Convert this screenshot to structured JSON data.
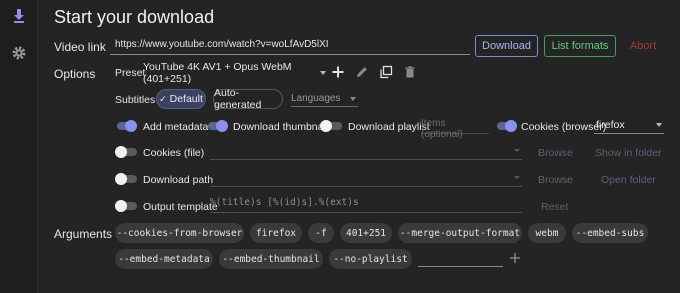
{
  "rail": {
    "icons": [
      "download-icon",
      "gear-icon"
    ]
  },
  "header": {
    "title": "Start your download"
  },
  "video_link": {
    "label": "Video link",
    "value": "https://www.youtube.com/watch?v=woLfAvD5lXI",
    "download_label": "Download",
    "formats_label": "List formats",
    "abort_label": "Abort"
  },
  "options": {
    "label": "Options",
    "preset_label": "Preset",
    "preset_value": "YouTube 4K AV1 + Opus WebM (401+251)",
    "subtitles_label": "Subtitles",
    "subtitles_default": "Default",
    "subtitles_auto": "Auto-generated",
    "languages_placeholder": "Languages"
  },
  "toggles": {
    "metadata": {
      "label": "Add metadata",
      "on": true
    },
    "thumbnail": {
      "label": "Download thumbnail",
      "on": true
    },
    "playlist": {
      "label": "Download playlist",
      "on": false,
      "items_placeholder": "Items (optional)"
    },
    "cookies_browser": {
      "label": "Cookies (browser)",
      "on": true,
      "browser": "firefox"
    },
    "cookies_file": {
      "label": "Cookies (file)",
      "on": false,
      "browse": "Browse",
      "show": "Show in folder"
    },
    "download_path": {
      "label": "Download path",
      "on": false,
      "browse": "Browse",
      "open": "Open folder"
    },
    "output_template": {
      "label": "Output template",
      "on": false,
      "value": "%(title)s [%(id)s].%(ext)s",
      "reset": "Reset"
    }
  },
  "arguments": {
    "label": "Arguments",
    "chips": [
      "--cookies-from-browser",
      "firefox",
      "-f",
      "401+251",
      "--merge-output-format",
      "webm",
      "--embed-subs",
      "--embed-metadata",
      "--embed-thumbnail",
      "--no-playlist"
    ]
  },
  "colors": {
    "accent": "#8892ee",
    "download_border": "#7b86d6",
    "formats_border": "#3ea05b",
    "abort_text": "#a33a3a",
    "background": "#242424"
  }
}
